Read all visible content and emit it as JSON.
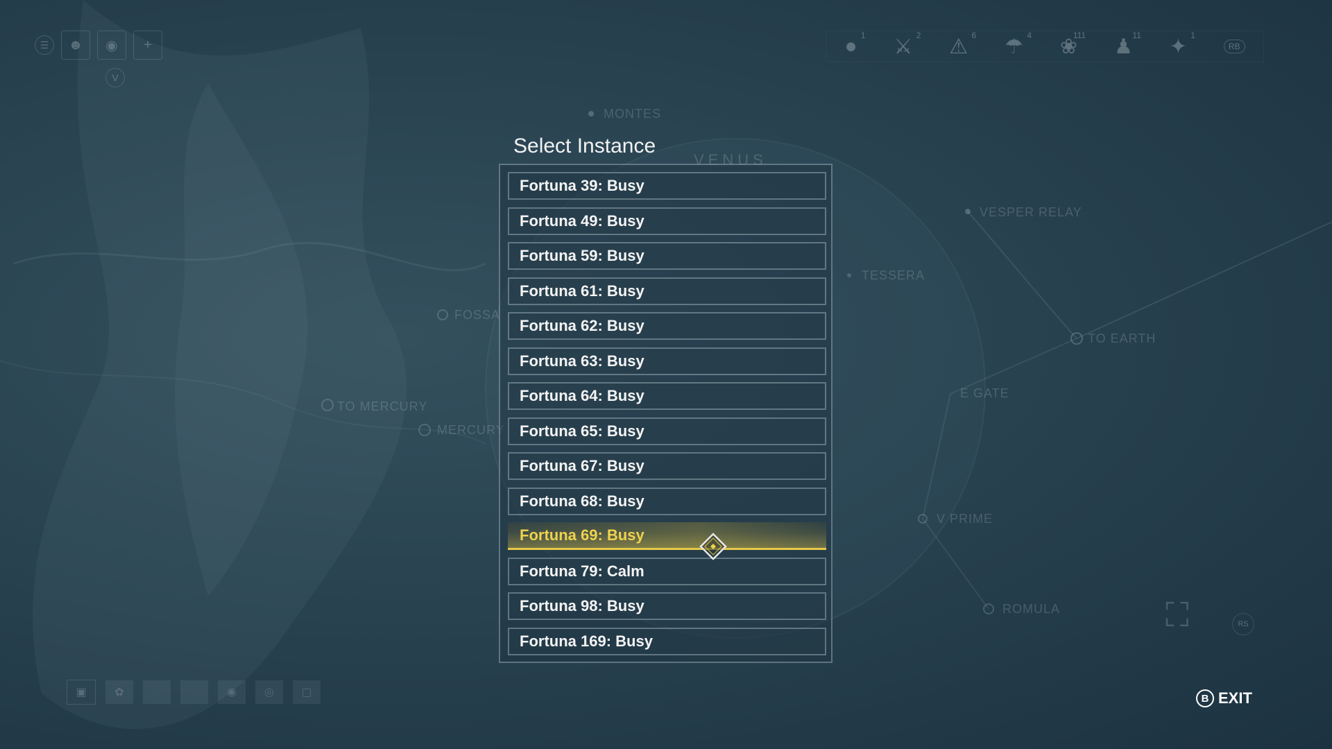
{
  "dialog": {
    "title": "Select Instance",
    "items": [
      {
        "label": "Fortuna 39: Busy",
        "selected": false
      },
      {
        "label": "Fortuna 49: Busy",
        "selected": false
      },
      {
        "label": "Fortuna 59: Busy",
        "selected": false
      },
      {
        "label": "Fortuna 61: Busy",
        "selected": false
      },
      {
        "label": "Fortuna 62: Busy",
        "selected": false
      },
      {
        "label": "Fortuna 63: Busy",
        "selected": false
      },
      {
        "label": "Fortuna 64: Busy",
        "selected": false
      },
      {
        "label": "Fortuna 65: Busy",
        "selected": false
      },
      {
        "label": "Fortuna 67: Busy",
        "selected": false
      },
      {
        "label": "Fortuna 68: Busy",
        "selected": false
      },
      {
        "label": "Fortuna 69: Busy",
        "selected": true
      },
      {
        "label": "Fortuna 79: Calm",
        "selected": false
      },
      {
        "label": "Fortuna 98: Busy",
        "selected": false
      },
      {
        "label": "Fortuna 169: Busy",
        "selected": false
      }
    ]
  },
  "exit": {
    "key": "B",
    "label": "EXIT"
  },
  "map_labels": {
    "montes": "MONTES",
    "venus": "VENUS",
    "vesper_relay": "VESPER RELAY",
    "tessera": "TESSERA",
    "fossa": "FOSSA",
    "to_earth": "TO EARTH",
    "mercury_junction": "TO MERCURY",
    "mercury": "MERCURY",
    "e_gate": "E GATE",
    "v_prime": "V PRIME",
    "romula": "ROMULA"
  },
  "hud_top_right": [
    {
      "icon": "alert-pin-icon",
      "count": "1"
    },
    {
      "icon": "crossed-swords-icon",
      "count": "2"
    },
    {
      "icon": "warning-triangle-icon",
      "count": "6"
    },
    {
      "icon": "mask-icon",
      "count": "4"
    },
    {
      "icon": "network-icon",
      "count": "111"
    },
    {
      "icon": "person-icon",
      "count": "11"
    },
    {
      "icon": "nodes-icon",
      "count": "1"
    }
  ],
  "hud_top_right_button": "RB",
  "hud_left_key": "V",
  "hud_right_stick": "RS",
  "colors": {
    "accent": "#eed24e",
    "text": "#f4f4f4",
    "background": "#2a4452"
  }
}
